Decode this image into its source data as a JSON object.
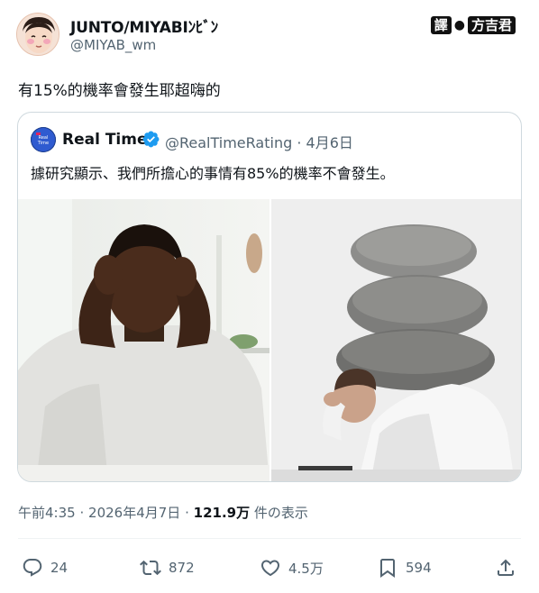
{
  "author": {
    "name": "JUNTO/MIYABIﾝﾋﾞﾝ",
    "handle": "@MIYAB_wm"
  },
  "watermark": {
    "left": "譯",
    "sep": "●",
    "right": "方吉君"
  },
  "tweet": {
    "text": "有15%的機率會發生耶超嗨的"
  },
  "quote": {
    "name": "Real Time",
    "handle": "@RealTimeRating",
    "date": "4月6日",
    "separator": "·",
    "text": "據研究顯示、我們所擔心的事情有85%的機率不會發生。",
    "avatar_text_1": "Real",
    "avatar_text_2": "Time"
  },
  "meta": {
    "time": "午前4:35",
    "separator": "·",
    "date": "2026年4月7日",
    "views": "121.9万",
    "views_suffix": "件の表示"
  },
  "actions": {
    "reply_count": "24",
    "retweet_count": "872",
    "like_count": "4.5万",
    "bookmark_count": "594"
  },
  "colors": {
    "verified": "#1d9bf0",
    "muted": "#536471",
    "text": "#0f1419",
    "border": "#cfd9de"
  }
}
